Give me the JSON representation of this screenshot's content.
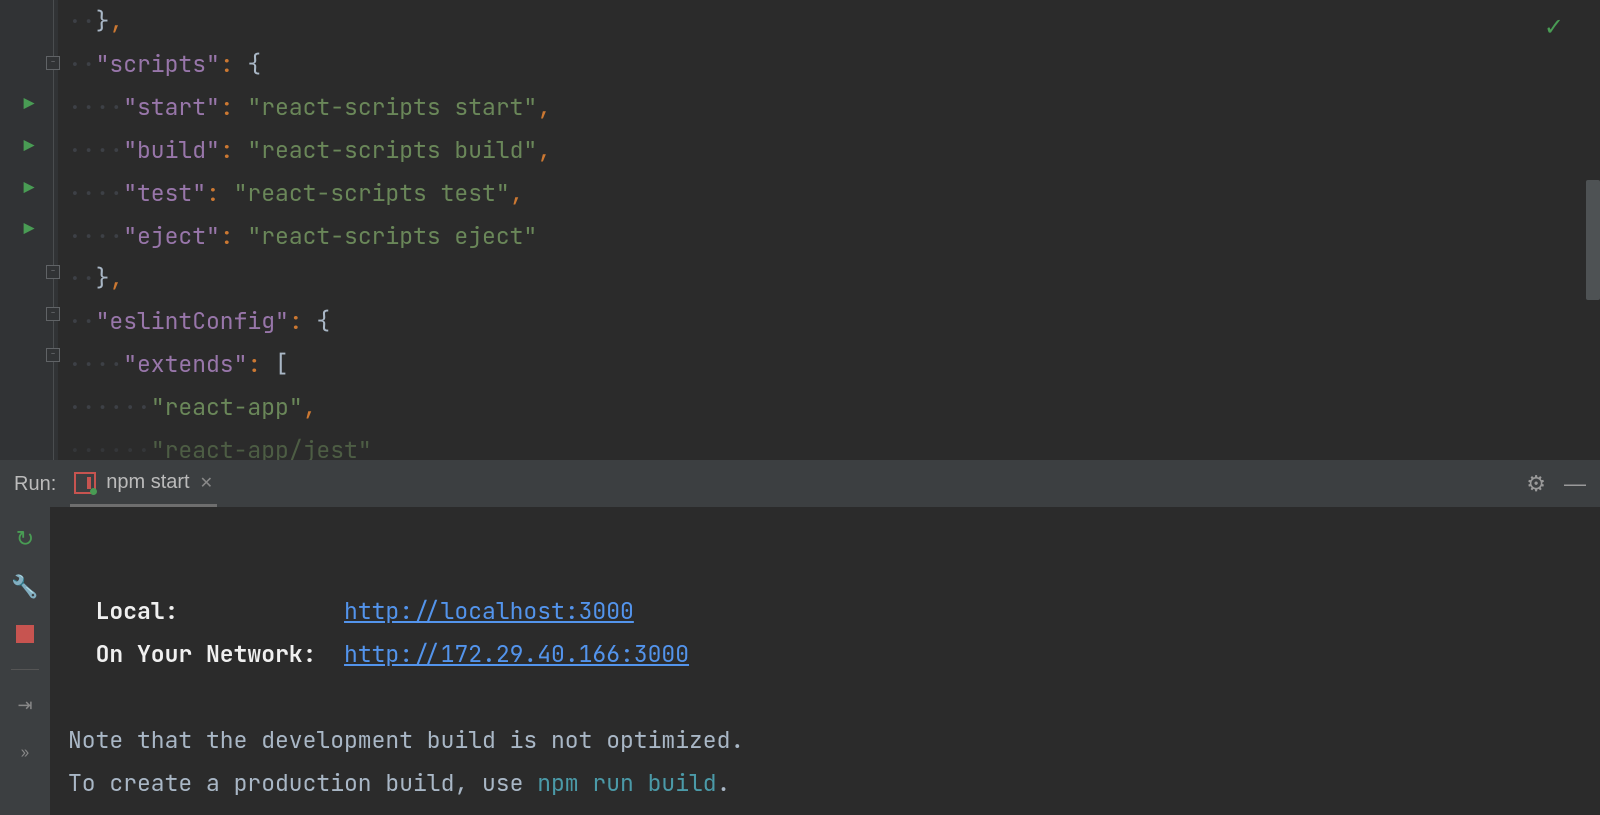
{
  "editor": {
    "lines": [
      {
        "indent": 1,
        "tokens": [
          [
            "brkt",
            "}"
          ],
          [
            "punc",
            ","
          ]
        ]
      },
      {
        "indent": 1,
        "fold": "-",
        "tokens": [
          [
            "key",
            "\"scripts\""
          ],
          [
            "punc",
            ": "
          ],
          [
            "brkt",
            "{"
          ]
        ]
      },
      {
        "indent": 2,
        "run": true,
        "tokens": [
          [
            "key",
            "\"start\""
          ],
          [
            "punc",
            ": "
          ],
          [
            "str",
            "\"react-scripts start\""
          ],
          [
            "punc",
            ","
          ]
        ]
      },
      {
        "indent": 2,
        "run": true,
        "tokens": [
          [
            "key",
            "\"build\""
          ],
          [
            "punc",
            ": "
          ],
          [
            "str",
            "\"react-scripts build\""
          ],
          [
            "punc",
            ","
          ]
        ]
      },
      {
        "indent": 2,
        "run": true,
        "tokens": [
          [
            "key",
            "\"test\""
          ],
          [
            "punc",
            ": "
          ],
          [
            "str",
            "\"react-scripts test\""
          ],
          [
            "punc",
            ","
          ]
        ]
      },
      {
        "indent": 2,
        "run": true,
        "tokens": [
          [
            "key",
            "\"eject\""
          ],
          [
            "punc",
            ": "
          ],
          [
            "str",
            "\"react-scripts eject\""
          ]
        ]
      },
      {
        "indent": 1,
        "fold": "-",
        "tokens": [
          [
            "brkt",
            "}"
          ],
          [
            "punc",
            ","
          ]
        ]
      },
      {
        "indent": 1,
        "fold": "-",
        "tokens": [
          [
            "key",
            "\"eslintConfig\""
          ],
          [
            "punc",
            ": "
          ],
          [
            "brkt",
            "{"
          ]
        ]
      },
      {
        "indent": 2,
        "fold": "-",
        "tokens": [
          [
            "key",
            "\"extends\""
          ],
          [
            "punc",
            ": "
          ],
          [
            "brkt",
            "["
          ]
        ]
      },
      {
        "indent": 3,
        "tokens": [
          [
            "str",
            "\"react-app\""
          ],
          [
            "punc",
            ","
          ]
        ]
      },
      {
        "indent": 3,
        "partial": true,
        "tokens": [
          [
            "str",
            "\"react-app/jest\""
          ]
        ]
      }
    ]
  },
  "runPanel": {
    "label": "Run:",
    "tabName": "npm start"
  },
  "console": {
    "localLabel": "Local:",
    "localUrl": "http://localhost:3000",
    "networkLabel": "On Your Network:",
    "networkUrl": "http://172.29.40.166:3000",
    "note1": "Note that the development build is not optimized.",
    "note2a": "To create a production build, use ",
    "note2cmd": "npm run build",
    "note2b": "."
  }
}
